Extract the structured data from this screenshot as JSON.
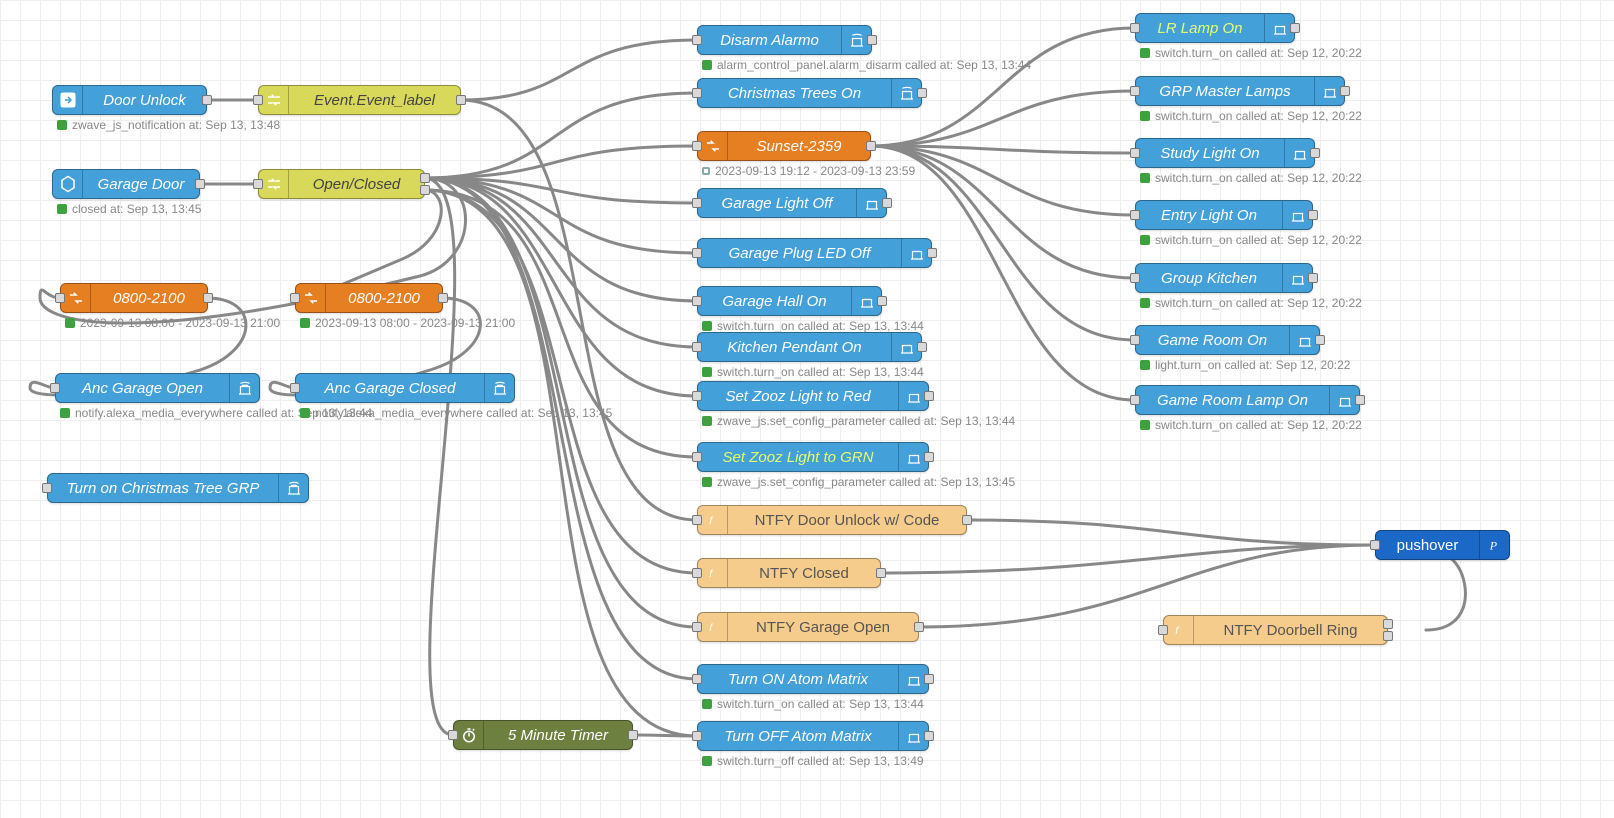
{
  "nodes": {
    "door_unlock": {
      "label": "Door Unlock",
      "status": "zwave_js_notification at: Sep 13, 13:48"
    },
    "garage_door": {
      "label": "Garage Door",
      "status": "closed at: Sep 13, 13:45"
    },
    "event_label": {
      "label": "Event.Event_label"
    },
    "open_closed": {
      "label": "Open/Closed"
    },
    "time1": {
      "label": "0800-2100",
      "status": "2023-09-13 08:00 - 2023-09-13 21:00"
    },
    "time2": {
      "label": "0800-2100",
      "status": "2023-09-13 08:00 - 2023-09-13 21:00"
    },
    "anc_open": {
      "label": "Anc Garage Open",
      "status": "notify.alexa_media_everywhere called at: Sep 13, 13:44"
    },
    "anc_closed": {
      "label": "Anc Garage Closed",
      "status": "notify.alexa_media_everywhere called at: Sep 13, 13:45"
    },
    "xmas_grp": {
      "label": "Turn on Christmas Tree GRP"
    },
    "timer5": {
      "label": "5 Minute Timer"
    },
    "disarm": {
      "label": "Disarm Alarmo",
      "status": "alarm_control_panel.alarm_disarm called at: Sep 13, 13:44"
    },
    "xmas_trees": {
      "label": "Christmas Trees On"
    },
    "sunset": {
      "label": "Sunset-2359",
      "status": "2023-09-13 19:12 - 2023-09-13 23:59"
    },
    "garage_light_off": {
      "label": "Garage Light Off"
    },
    "garage_plug": {
      "label": "Garage Plug LED Off"
    },
    "garage_hall": {
      "label": "Garage Hall On",
      "status": "switch.turn_on called at: Sep 13, 13:44"
    },
    "kitchen_pendant": {
      "label": "Kitchen Pendant On",
      "status": "switch.turn_on called at: Sep 13, 13:44"
    },
    "zooz_red": {
      "label": "Set Zooz Light to Red",
      "status": "zwave_js.set_config_parameter called at: Sep 13, 13:44"
    },
    "zooz_grn": {
      "label": "Set Zooz Light to GRN",
      "status": "zwave_js.set_config_parameter called at: Sep 13, 13:45"
    },
    "ntfy_unlock": {
      "label": "NTFY Door Unlock w/ Code"
    },
    "ntfy_closed": {
      "label": "NTFY Closed"
    },
    "ntfy_garage_open": {
      "label": "NTFY Garage Open"
    },
    "atom_on": {
      "label": "Turn ON Atom Matrix",
      "status": "switch.turn_on called at: Sep 13, 13:44"
    },
    "atom_off": {
      "label": "Turn OFF Atom Matrix",
      "status": "switch.turn_off called at: Sep 13, 13:49"
    },
    "lr_lamp": {
      "label": "LR Lamp On",
      "status": "switch.turn_on called at: Sep 12, 20:22"
    },
    "grp_master": {
      "label": "GRP Master Lamps",
      "status": "switch.turn_on called at: Sep 12, 20:22"
    },
    "study": {
      "label": "Study Light On",
      "status": "switch.turn_on called at: Sep 12, 20:22"
    },
    "entry": {
      "label": "Entry Light On",
      "status": "switch.turn_on called at: Sep 12, 20:22"
    },
    "group_kitchen": {
      "label": "Group Kitchen",
      "status": "switch.turn_on called at: Sep 12, 20:22"
    },
    "game_room": {
      "label": "Game Room On",
      "status": "light.turn_on called at: Sep 12, 20:22"
    },
    "game_room_lamp": {
      "label": "Game Room Lamp On",
      "status": "switch.turn_on called at: Sep 12, 20:22"
    },
    "ntfy_doorbell": {
      "label": "NTFY Doorbell Ring"
    },
    "pushover": {
      "label": "pushover"
    }
  }
}
